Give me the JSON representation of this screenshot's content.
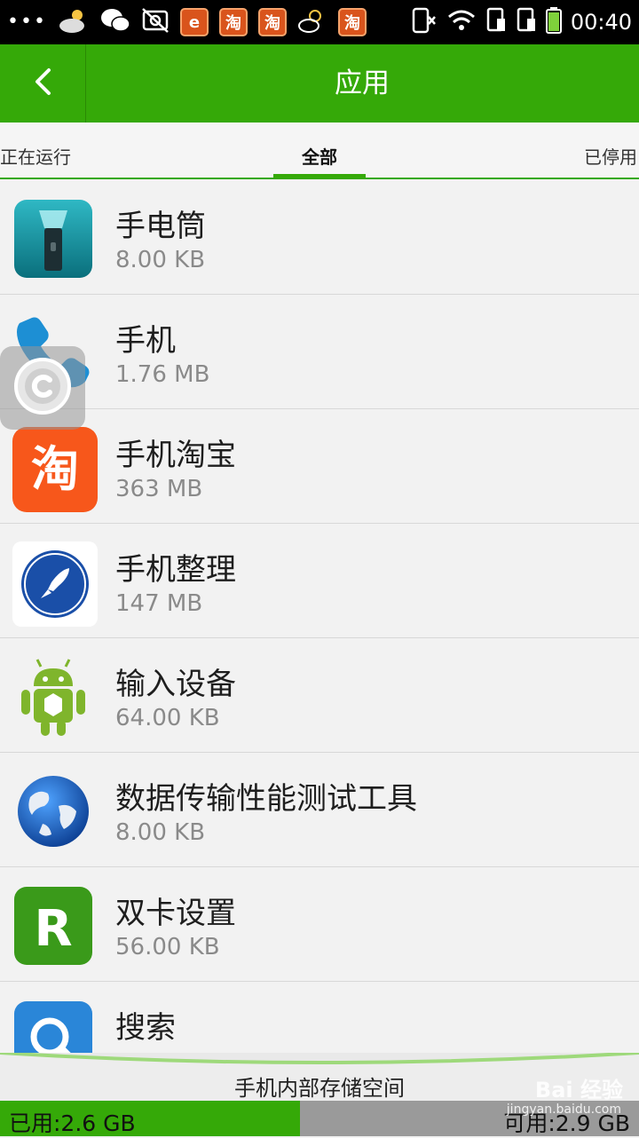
{
  "status_bar": {
    "time": "00:40",
    "more_dots": "•••",
    "taobao_badge": "淘",
    "colors": {
      "background": "#000000",
      "taobao": "#d9541c"
    },
    "icons": [
      "cloud-sun-icon",
      "wechat-icon",
      "photo-off-icon",
      "browser-e-icon",
      "taobao-icon",
      "taobao-icon",
      "weather-icon",
      "taobao-icon",
      "phone-silent-icon",
      "wifi-icon",
      "sim1-icon",
      "sim2-icon",
      "battery-icon"
    ]
  },
  "action_bar": {
    "title": "应用",
    "back_icon": "chevron-left-icon",
    "color": "#35a908"
  },
  "tabs": [
    {
      "label": "正在运行",
      "selected": false
    },
    {
      "label": "全部",
      "selected": true
    },
    {
      "label": "已停用",
      "selected": false
    }
  ],
  "apps": [
    {
      "name": "手电筒",
      "size": "8.00 KB",
      "icon": "flashlight-icon"
    },
    {
      "name": "手机",
      "size": "1.76 MB",
      "icon": "phone-icon"
    },
    {
      "name": "手机淘宝",
      "size": "363 MB",
      "icon": "taobao-icon",
      "icon_text": "淘"
    },
    {
      "name": "手机整理",
      "size": "147 MB",
      "icon": "rocket-icon"
    },
    {
      "name": "输入设备",
      "size": "64.00 KB",
      "icon": "android-icon"
    },
    {
      "name": "数据传输性能测试工具",
      "size": "8.00 KB",
      "icon": "globe-icon"
    },
    {
      "name": "双卡设置",
      "size": "56.00 KB",
      "icon": "dual-sim-icon",
      "icon_text": "R"
    },
    {
      "name": "搜索",
      "size": "",
      "icon": "search-icon"
    }
  ],
  "storage": {
    "label": "手机内部存储空间",
    "used": "已用:2.6 GB",
    "free": "可用:2.9 GB",
    "used_fraction": 0.47
  },
  "watermark": {
    "brand": "Bai 经验",
    "url": "jingyan.baidu.com"
  }
}
